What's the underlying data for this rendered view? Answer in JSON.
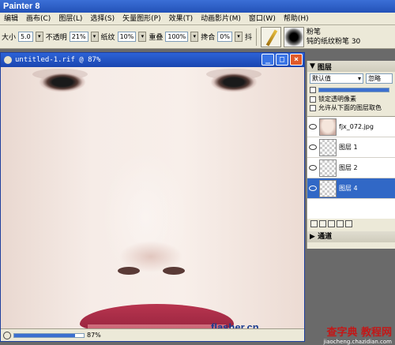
{
  "app": {
    "title": "Painter 8"
  },
  "menu": [
    "编辑",
    "画布(C)",
    "图层(L)",
    "选择(S)",
    "矢量图形(P)",
    "效果(T)",
    "动画影片(M)",
    "窗口(W)",
    "帮助(H)"
  ],
  "toolbar": {
    "size_label": "大小",
    "size_value": "5.0",
    "opacity_label": "不透明",
    "opacity_value": "21%",
    "grain_label": "纸纹",
    "grain_value": "10%",
    "resat_label": "重叠",
    "resat_value": "100%",
    "bleed_label": "搀合",
    "bleed_value": "0%",
    "jitter_label": "抖",
    "brush_category": "粉笔",
    "brush_variant": "钝的纸纹粉笔 30"
  },
  "document": {
    "title": "untitled-1.rif @ 87%",
    "zoom": "87%",
    "zoom_fraction": 0.87,
    "watermark": "flasher.cn"
  },
  "layers_panel": {
    "title": "图层",
    "composite_method": "默认值",
    "ignore_label": "忽略",
    "options": [
      "锁定透明像素",
      "允许从下面的图层取色"
    ],
    "layers": [
      {
        "name": "fjx_072.jpg",
        "type": "image"
      },
      {
        "name": "图层 1",
        "type": "empty"
      },
      {
        "name": "图层 2",
        "type": "empty"
      },
      {
        "name": "图层 4",
        "type": "empty",
        "selected": true
      }
    ],
    "channels_label": "通道"
  },
  "banner": {
    "text": "查字典 教程网",
    "url": "jiaocheng.chazidian.com"
  },
  "colors": {
    "titlebar": "#2352b8",
    "selection": "#3168c6",
    "lip": "#a82c47"
  }
}
